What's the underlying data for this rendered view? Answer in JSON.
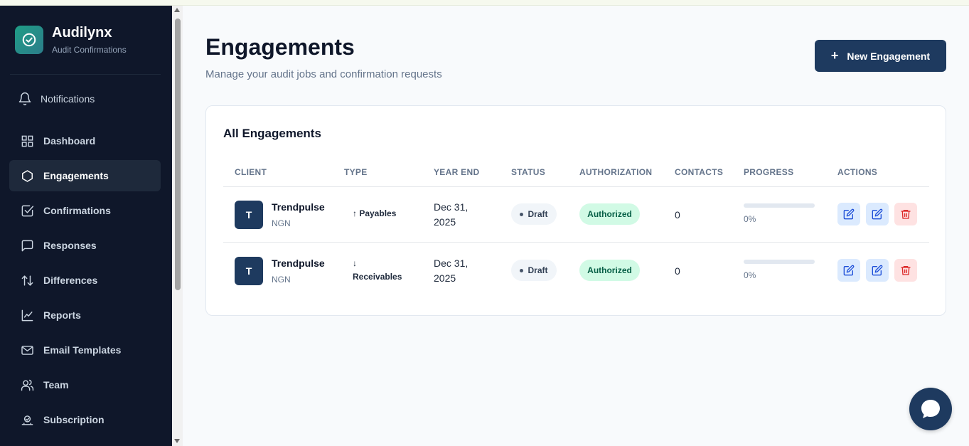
{
  "brand": {
    "name": "Audilynx",
    "subtitle": "Audit Confirmations"
  },
  "notifications": {
    "label": "Notifications"
  },
  "sidebar": {
    "items": [
      {
        "label": "Dashboard",
        "icon": "grid-icon",
        "active": false
      },
      {
        "label": "Engagements",
        "icon": "hexagon-icon",
        "active": true
      },
      {
        "label": "Confirmations",
        "icon": "checkbox-icon",
        "active": false
      },
      {
        "label": "Responses",
        "icon": "message-icon",
        "active": false
      },
      {
        "label": "Differences",
        "icon": "arrows-up-down-icon",
        "active": false
      },
      {
        "label": "Reports",
        "icon": "line-chart-icon",
        "active": false
      },
      {
        "label": "Email Templates",
        "icon": "mail-icon",
        "active": false
      },
      {
        "label": "Team",
        "icon": "users-icon",
        "active": false
      },
      {
        "label": "Subscription",
        "icon": "subscription-icon",
        "active": false
      }
    ]
  },
  "header": {
    "title": "Engagements",
    "subtitle": "Manage your audit jobs and confirmation requests",
    "new_button_label": "New Engagement"
  },
  "table": {
    "title": "All Engagements",
    "columns": [
      "CLIENT",
      "TYPE",
      "YEAR END",
      "STATUS",
      "AUTHORIZATION",
      "CONTACTS",
      "PROGRESS",
      "ACTIONS"
    ],
    "rows": [
      {
        "avatar": "T",
        "client": "Trendpulse",
        "currency": "NGN",
        "type_line1": "↑ Payables",
        "type_line2": "",
        "year_end_line1": "Dec 31,",
        "year_end_line2": "2025",
        "status": "Draft",
        "authorization": "Authorized",
        "contacts": "0",
        "progress": 0,
        "progress_label": "0%"
      },
      {
        "avatar": "T",
        "client": "Trendpulse",
        "currency": "NGN",
        "type_line1": "↓",
        "type_line2": "Receivables",
        "year_end_line1": "Dec 31,",
        "year_end_line2": "2025",
        "status": "Draft",
        "authorization": "Authorized",
        "contacts": "0",
        "progress": 0,
        "progress_label": "0%"
      }
    ]
  },
  "colors": {
    "sidebar_bg": "#0f172a",
    "primary": "#1e3a5f",
    "authorized_bg": "#d1fae5",
    "delete_bg": "#fee2e2",
    "edit_bg": "#dbeafe"
  }
}
